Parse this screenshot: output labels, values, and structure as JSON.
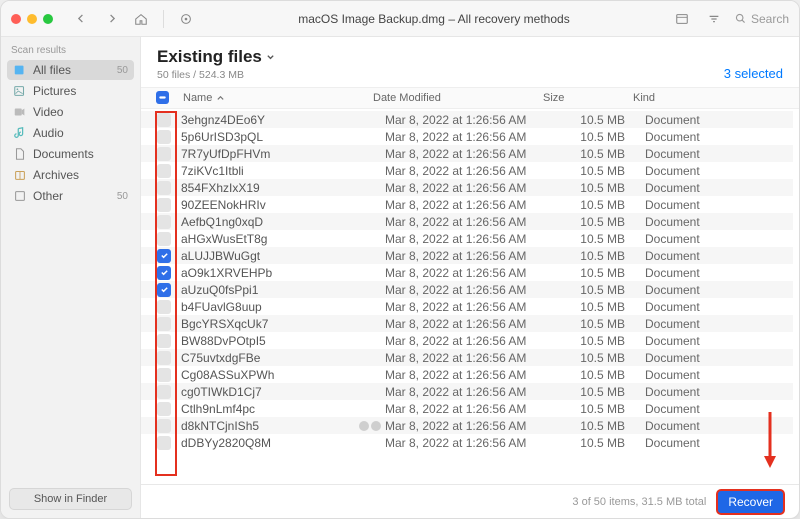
{
  "titlebar": {
    "title": "macOS Image Backup.dmg – All recovery methods",
    "search_placeholder": "Search"
  },
  "sidebar": {
    "header": "Scan results",
    "items": [
      {
        "label": "All files",
        "count": "50",
        "icon": "files",
        "selected": true
      },
      {
        "label": "Pictures",
        "count": "",
        "icon": "picture",
        "selected": false
      },
      {
        "label": "Video",
        "count": "",
        "icon": "video",
        "selected": false
      },
      {
        "label": "Audio",
        "count": "",
        "icon": "audio",
        "selected": false
      },
      {
        "label": "Documents",
        "count": "",
        "icon": "doc",
        "selected": false
      },
      {
        "label": "Archives",
        "count": "",
        "icon": "archive",
        "selected": false
      },
      {
        "label": "Other",
        "count": "50",
        "icon": "other",
        "selected": false
      }
    ],
    "footer_button": "Show in Finder"
  },
  "main": {
    "title": "Existing files",
    "subtitle": "50 files / 524.3 MB",
    "selected_text": "3 selected",
    "columns": {
      "name": "Name",
      "date": "Date Modified",
      "size": "Size",
      "kind": "Kind"
    },
    "rows": [
      {
        "name": "3ehgnz4DEo6Y",
        "date": "Mar 8, 2022 at 1:26:56 AM",
        "size": "10.5 MB",
        "kind": "Document",
        "checked": false,
        "badges": 0
      },
      {
        "name": "5p6UrISD3pQL",
        "date": "Mar 8, 2022 at 1:26:56 AM",
        "size": "10.5 MB",
        "kind": "Document",
        "checked": false,
        "badges": 0
      },
      {
        "name": "7R7yUfDpFHVm",
        "date": "Mar 8, 2022 at 1:26:56 AM",
        "size": "10.5 MB",
        "kind": "Document",
        "checked": false,
        "badges": 0
      },
      {
        "name": "7ziKVc1Itbli",
        "date": "Mar 8, 2022 at 1:26:56 AM",
        "size": "10.5 MB",
        "kind": "Document",
        "checked": false,
        "badges": 0
      },
      {
        "name": "854FXhzIxX19",
        "date": "Mar 8, 2022 at 1:26:56 AM",
        "size": "10.5 MB",
        "kind": "Document",
        "checked": false,
        "badges": 0
      },
      {
        "name": "90ZEENokHRIv",
        "date": "Mar 8, 2022 at 1:26:56 AM",
        "size": "10.5 MB",
        "kind": "Document",
        "checked": false,
        "badges": 0
      },
      {
        "name": "AefbQ1ng0xqD",
        "date": "Mar 8, 2022 at 1:26:56 AM",
        "size": "10.5 MB",
        "kind": "Document",
        "checked": false,
        "badges": 0
      },
      {
        "name": "aHGxWusEtT8g",
        "date": "Mar 8, 2022 at 1:26:56 AM",
        "size": "10.5 MB",
        "kind": "Document",
        "checked": false,
        "badges": 0
      },
      {
        "name": "aLUJJBWuGgt",
        "date": "Mar 8, 2022 at 1:26:56 AM",
        "size": "10.5 MB",
        "kind": "Document",
        "checked": true,
        "badges": 0
      },
      {
        "name": "aO9k1XRVEHPb",
        "date": "Mar 8, 2022 at 1:26:56 AM",
        "size": "10.5 MB",
        "kind": "Document",
        "checked": true,
        "badges": 0
      },
      {
        "name": "aUzuQ0fsPpi1",
        "date": "Mar 8, 2022 at 1:26:56 AM",
        "size": "10.5 MB",
        "kind": "Document",
        "checked": true,
        "badges": 0
      },
      {
        "name": "b4FUavlG8uup",
        "date": "Mar 8, 2022 at 1:26:56 AM",
        "size": "10.5 MB",
        "kind": "Document",
        "checked": false,
        "badges": 0
      },
      {
        "name": "BgcYRSXqcUk7",
        "date": "Mar 8, 2022 at 1:26:56 AM",
        "size": "10.5 MB",
        "kind": "Document",
        "checked": false,
        "badges": 0
      },
      {
        "name": "BW88DvPOtpI5",
        "date": "Mar 8, 2022 at 1:26:56 AM",
        "size": "10.5 MB",
        "kind": "Document",
        "checked": false,
        "badges": 0
      },
      {
        "name": "C75uvtxdgFBe",
        "date": "Mar 8, 2022 at 1:26:56 AM",
        "size": "10.5 MB",
        "kind": "Document",
        "checked": false,
        "badges": 0
      },
      {
        "name": "Cg08ASSuXPWh",
        "date": "Mar 8, 2022 at 1:26:56 AM",
        "size": "10.5 MB",
        "kind": "Document",
        "checked": false,
        "badges": 0
      },
      {
        "name": "cg0TIWkD1Cj7",
        "date": "Mar 8, 2022 at 1:26:56 AM",
        "size": "10.5 MB",
        "kind": "Document",
        "checked": false,
        "badges": 0
      },
      {
        "name": "Ctlh9nLmf4pc",
        "date": "Mar 8, 2022 at 1:26:56 AM",
        "size": "10.5 MB",
        "kind": "Document",
        "checked": false,
        "badges": 0
      },
      {
        "name": "d8kNTCjnISh5",
        "date": "Mar 8, 2022 at 1:26:56 AM",
        "size": "10.5 MB",
        "kind": "Document",
        "checked": false,
        "badges": 2
      },
      {
        "name": "dDBYy2820Q8M",
        "date": "Mar 8, 2022 at 1:26:56 AM",
        "size": "10.5 MB",
        "kind": "Document",
        "checked": false,
        "badges": 0
      }
    ]
  },
  "footer": {
    "status": "3 of 50 items, 31.5 MB total",
    "recover_label": "Recover"
  }
}
